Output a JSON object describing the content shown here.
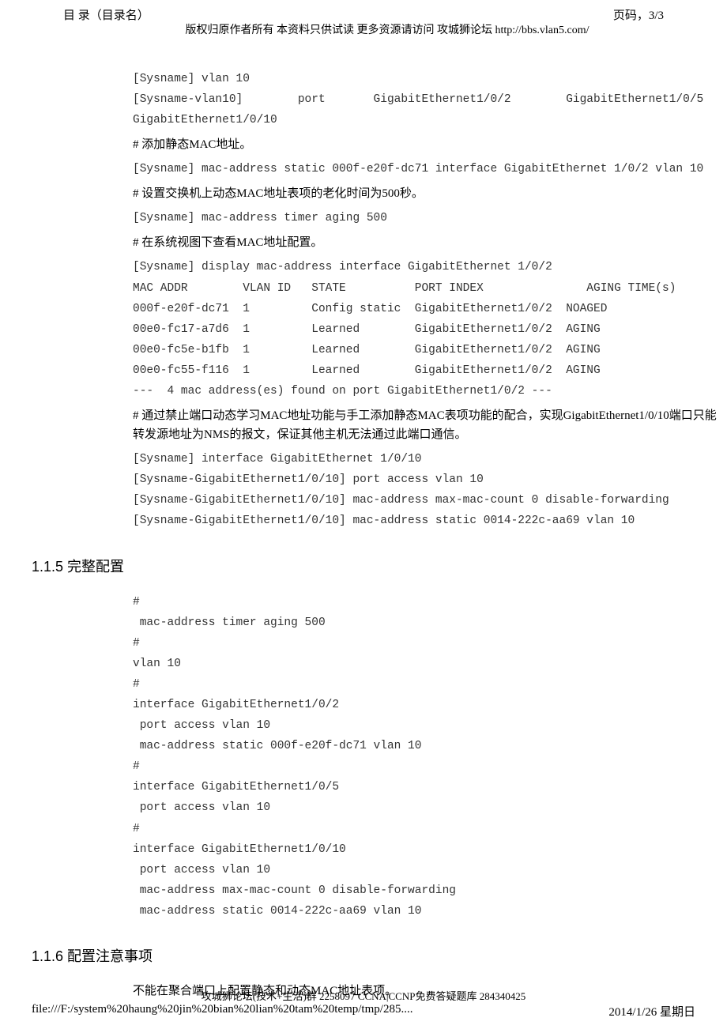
{
  "header": {
    "left": "目 录（目录名）",
    "right": "页码，3/3",
    "copyright": "版权归原作者所有 本资料只供试读 更多资源请访问 攻城狮论坛 http://bbs.vlan5.com/"
  },
  "block1": {
    "code1": "[Sysname] vlan 10\n[Sysname-vlan10]        port       GigabitEthernet1/0/2        GigabitEthernet1/0/5\nGigabitEthernet1/0/10",
    "text1": "# 添加静态MAC地址。",
    "code2": "[Sysname] mac-address static 000f-e20f-dc71 interface GigabitEthernet 1/0/2 vlan 10",
    "text2": "# 设置交换机上动态MAC地址表项的老化时间为500秒。",
    "code3": "[Sysname] mac-address timer aging 500",
    "text3": "# 在系统视图下查看MAC地址配置。",
    "code4": "[Sysname] display mac-address interface GigabitEthernet 1/0/2\nMAC ADDR        VLAN ID   STATE          PORT INDEX               AGING TIME(s)\n000f-e20f-dc71  1         Config static  GigabitEthernet1/0/2  NOAGED\n00e0-fc17-a7d6  1         Learned        GigabitEthernet1/0/2  AGING\n00e0-fc5e-b1fb  1         Learned        GigabitEthernet1/0/2  AGING\n00e0-fc55-f116  1         Learned        GigabitEthernet1/0/2  AGING\n---  4 mac address(es) found on port GigabitEthernet1/0/2 ---",
    "text4": "# 通过禁止端口动态学习MAC地址功能与手工添加静态MAC表项功能的配合，实现GigabitEthernet1/0/10端口只能转发源地址为NMS的报文，保证其他主机无法通过此端口通信。",
    "code5": "[Sysname] interface GigabitEthernet 1/0/10\n[Sysname-GigabitEthernet1/0/10] port access vlan 10\n[Sysname-GigabitEthernet1/0/10] mac-address max-mac-count 0 disable-forwarding\n[Sysname-GigabitEthernet1/0/10] mac-address static 0014-222c-aa69 vlan 10"
  },
  "section115": {
    "heading": "1.1.5  完整配置",
    "code": "#\n mac-address timer aging 500\n#\nvlan 10\n#\ninterface GigabitEthernet1/0/2\n port access vlan 10\n mac-address static 000f-e20f-dc71 vlan 10\n#\ninterface GigabitEthernet1/0/5\n port access vlan 10\n#\ninterface GigabitEthernet1/0/10\n port access vlan 10\n mac-address max-mac-count 0 disable-forwarding\n mac-address static 0014-222c-aa69 vlan 10"
  },
  "section116": {
    "heading": "1.1.6  配置注意事项",
    "text": "不能在聚合端口上配置静态和动态MAC地址表项。"
  },
  "footer": {
    "group": "攻城狮论坛(技术+生活)群 2258097 CCNA|CCNP免费答疑题库 284340425",
    "path": "file:///F:/system%20haung%20jin%20bian%20lian%20tam%20temp/tmp/285....",
    "date": "2014/1/26 星期日"
  }
}
